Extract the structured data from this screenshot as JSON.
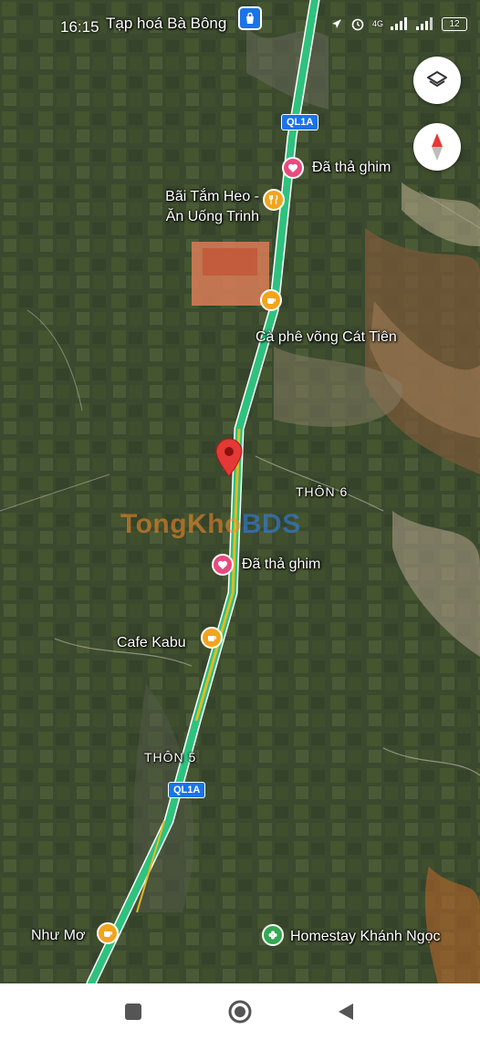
{
  "status_bar": {
    "time": "16:15",
    "network": "4G",
    "battery": "12"
  },
  "map": {
    "places": {
      "top": "Tạp hoá Bà Bông",
      "pinned_top": "Đã thả ghim",
      "restaurant_line1": "Bãi Tắm Heo -",
      "restaurant_line2": "Ăn Uống Trinh",
      "cafe_top": "Cà phê võng Cát Tiên",
      "thon6": "THÔN 6",
      "pinned_mid": "Đã thả ghim",
      "cafe_kabu": "Cafe Kabu",
      "thon5": "THÔN 5",
      "nhu_mo": "Như Mơ",
      "homestay": "Homestay Khánh Ngọc"
    },
    "road_shields": [
      "QL1A",
      "QL1A"
    ],
    "watermark_part1": "TongKho",
    "watermark_part2": "BDS",
    "colors": {
      "highway": "#2ec27e",
      "highway_yellow": "#e8b820",
      "pin_red": "#e53935",
      "pinned_pink": "#e84a7f",
      "food_orange": "#f2a41c",
      "homestay_green": "#34a853"
    },
    "icons": {
      "layers": "layers-icon",
      "compass": "compass-icon"
    }
  },
  "nav_bar": {
    "recents": "square-icon",
    "home": "circle-icon",
    "back": "triangle-back-icon"
  }
}
